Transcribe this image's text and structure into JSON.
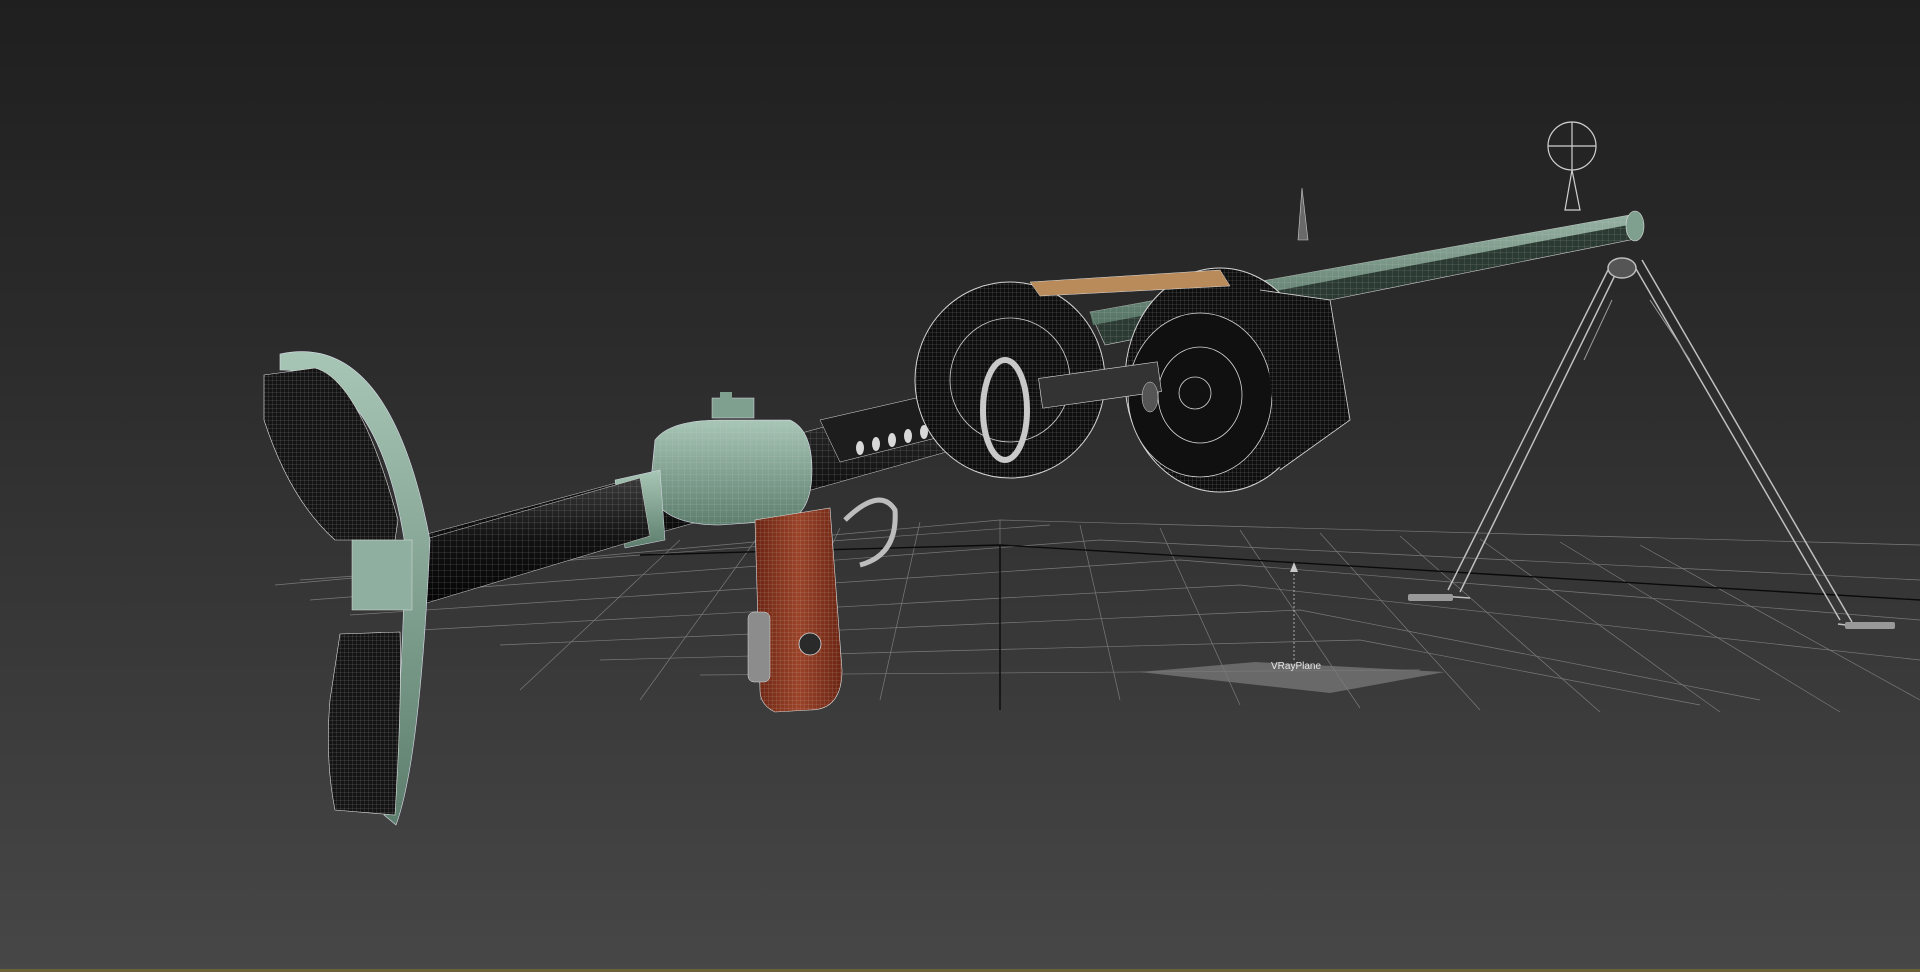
{
  "viewport": {
    "background_top": "#1f1f1f",
    "background_bottom": "#474747"
  },
  "scene": {
    "grid_color": "#8a8a8a",
    "mint_color": "#7fa08f",
    "dark_metal_color": "#1a1a1a",
    "grip_color": "#8b3a22",
    "wood_color": "#b98a5a",
    "wire_color": "#d8d8d8"
  },
  "objects": {
    "vray_plane_label": "VRayPlane"
  }
}
